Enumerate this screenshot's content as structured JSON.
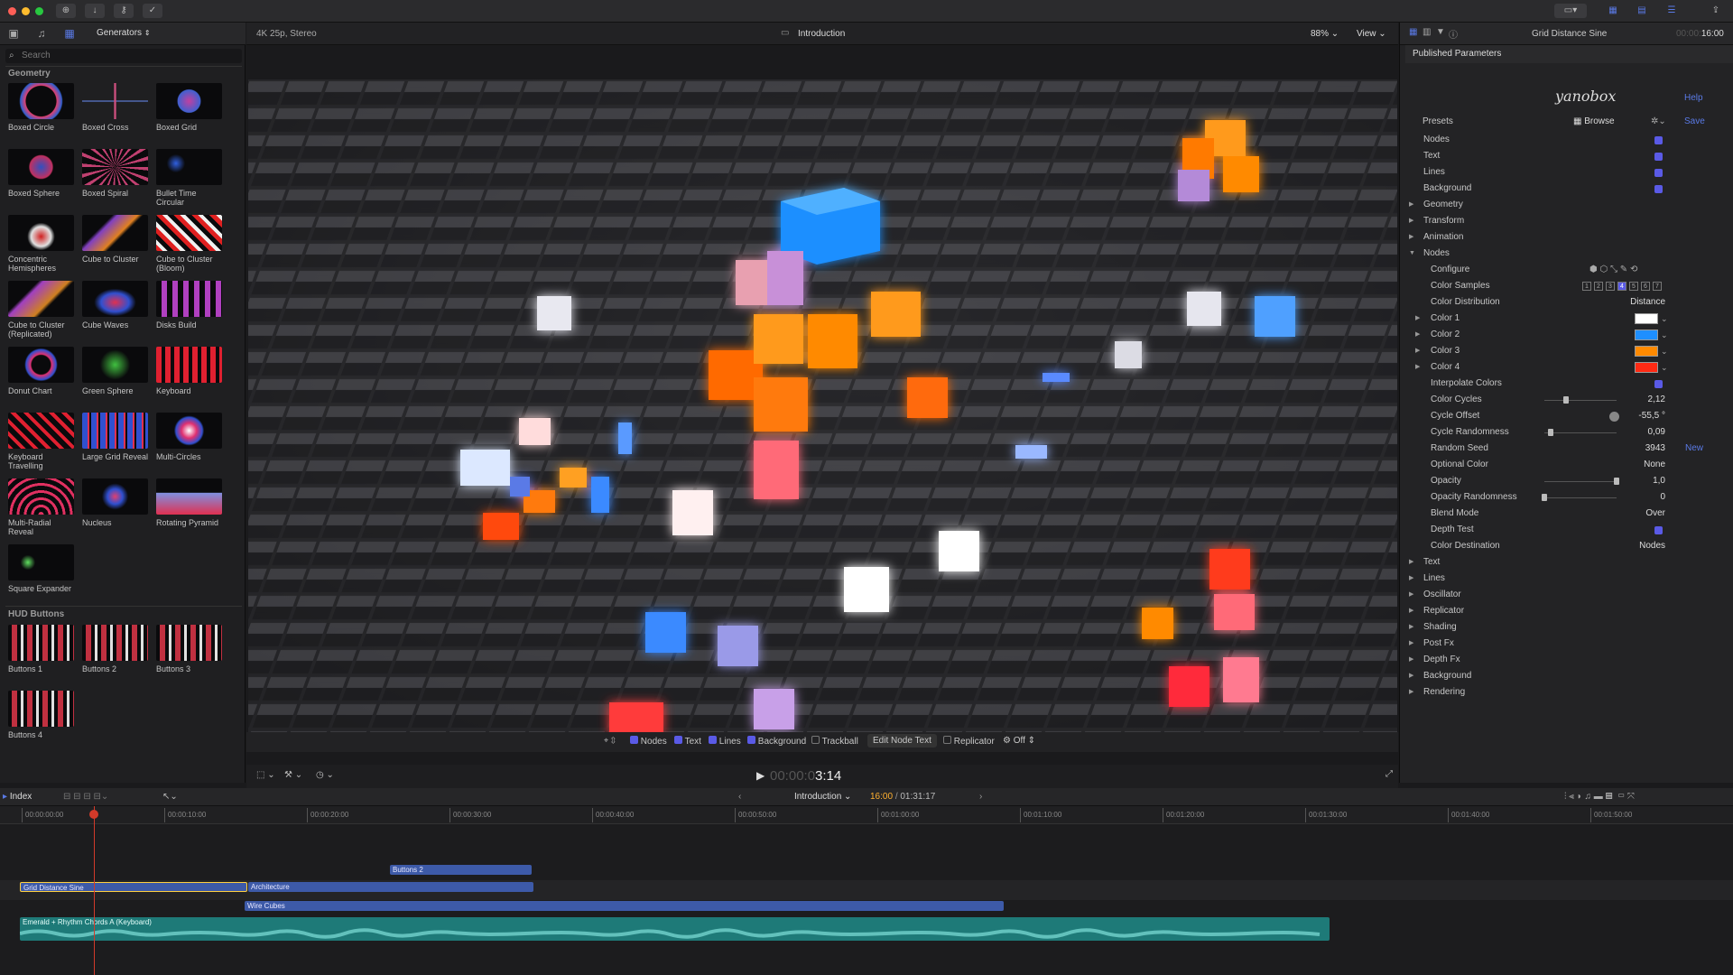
{
  "toolbar": {
    "generators_label": "Generators",
    "search_placeholder": "Search"
  },
  "browser": {
    "sections": [
      {
        "title": "Geometry",
        "items": [
          "Boxed Circle",
          "Boxed Cross",
          "Boxed Grid",
          "Boxed Sphere",
          "Boxed Spiral",
          "Bullet Time Circular",
          "Concentric Hemispheres",
          "Cube to Cluster",
          "Cube to Cluster (Bloom)",
          "Cube to Cluster (Replicated)",
          "Cube Waves",
          "Disks Build",
          "Donut Chart",
          "Green Sphere",
          "Keyboard",
          "Keyboard Travelling",
          "Large Grid Reveal",
          "Multi-Circles",
          "Multi-Radial Reveal",
          "Nucleus",
          "Rotating Pyramid",
          "Square Expander"
        ]
      },
      {
        "title": "HUD Buttons",
        "items": [
          "Buttons 1",
          "Buttons 2",
          "Buttons 3",
          "Buttons 4"
        ]
      }
    ]
  },
  "viewer": {
    "format": "4K 25p, Stereo",
    "title": "Introduction",
    "zoom": "88%",
    "view_label": "View",
    "checkboxes": [
      "Nodes",
      "Text",
      "Lines",
      "Background"
    ],
    "trackball": "Trackball",
    "edit_node_text": "Edit Node Text",
    "replicator": "Replicator",
    "off": "Off",
    "timecode_dim": "00:00:0",
    "timecode": "3:14"
  },
  "inspector": {
    "title": "Grid Distance Sine",
    "duration_dim": "00:00:",
    "duration": "16:00",
    "published": "Published Parameters",
    "brand": "yanobox",
    "help": "Help",
    "presets": "Presets",
    "browse": "Browse",
    "save": "Save",
    "rows": {
      "nodes": "Nodes",
      "text": "Text",
      "lines": "Lines",
      "background": "Background",
      "geometry": "Geometry",
      "transform": "Transform",
      "animation": "Animation",
      "nodes_group": "Nodes",
      "configure": "Configure",
      "color_samples": "Color Samples",
      "color_distribution": "Color Distribution",
      "color_distribution_val": "Distance",
      "color1": "Color 1",
      "color2": "Color 2",
      "color3": "Color 3",
      "color4": "Color 4",
      "interpolate": "Interpolate Colors",
      "color_cycles": "Color Cycles",
      "color_cycles_val": "2,12",
      "cycle_offset": "Cycle Offset",
      "cycle_offset_val": "-55,5 °",
      "cycle_rand": "Cycle Randomness",
      "cycle_rand_val": "0,09",
      "random_seed": "Random Seed",
      "random_seed_val": "3943",
      "new": "New",
      "optional_color": "Optional Color",
      "optional_color_val": "None",
      "opacity": "Opacity",
      "opacity_val": "1,0",
      "opacity_rand": "Opacity Randomness",
      "opacity_rand_val": "0",
      "blend_mode": "Blend Mode",
      "blend_mode_val": "Over",
      "depth_test": "Depth Test",
      "color_dest": "Color Destination",
      "color_dest_val": "Nodes",
      "g_text": "Text",
      "g_lines": "Lines",
      "g_osc": "Oscillator",
      "g_rep": "Replicator",
      "g_shading": "Shading",
      "g_postfx": "Post Fx",
      "g_depthfx": "Depth Fx",
      "g_background": "Background",
      "g_rendering": "Rendering"
    },
    "samples": [
      "1",
      "2",
      "3",
      "4",
      "5",
      "6",
      "7"
    ],
    "colors": {
      "c1": "#ffffff",
      "c2": "#1e8fff",
      "c3": "#ff8a00",
      "c4": "#ff2a14"
    }
  },
  "timeline": {
    "index": "Index",
    "project": "Introduction",
    "position": "16:00",
    "total": "01:31:17",
    "ruler": [
      "00:00:00:00",
      "00:00:10:00",
      "00:00:20:00",
      "00:00:30:00",
      "00:00:40:00",
      "00:00:50:00",
      "00:01:00:00",
      "00:01:10:00",
      "00:01:20:00",
      "00:01:30:00",
      "00:01:40:00",
      "00:01:50:00"
    ],
    "clips": {
      "buttons2": "Buttons 2",
      "grid": "Grid Distance Sine",
      "architecture": "Architecture",
      "wire": "Wire Cubes",
      "audio": "Emerald + Rhythm Chords A (Keyboard)"
    }
  }
}
